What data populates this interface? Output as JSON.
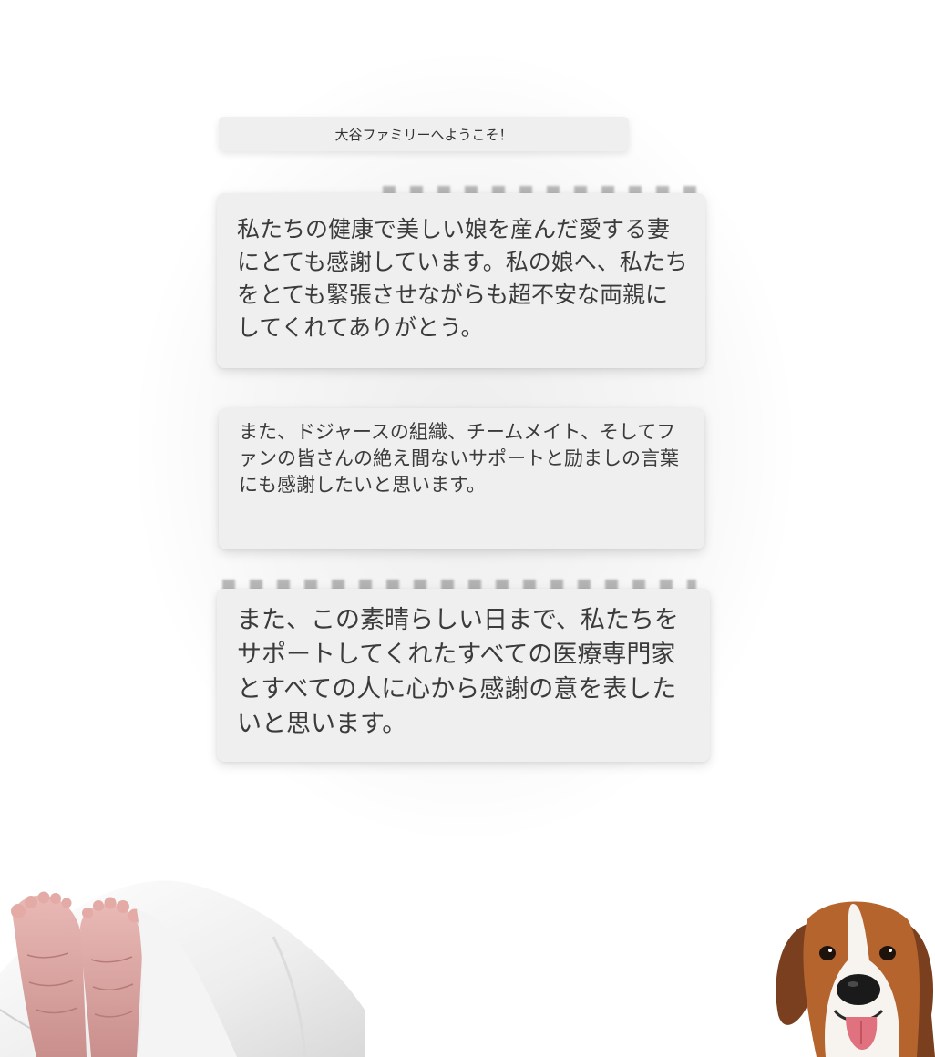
{
  "welcome_title": "大谷ファミリーへようこそ！",
  "messages": [
    {
      "text": "私たちの健康で美しい娘を産んだ愛する妻にとても感謝しています。私の娘へ、私たちをとても緊張させながらも超不安な両親にしてくれてありがとう。"
    },
    {
      "text": "また、ドジャースの組織、チームメイト、そしてファンの皆さんの絶え間ないサポートと励ましの言葉にも感謝したいと思います。"
    },
    {
      "text": "また、この素晴らしい日まで、私たちをサポートしてくれたすべての医療専門家とすべての人に心から感謝の意を表したいと思います。"
    }
  ],
  "colors": {
    "card_background": "#efefef",
    "text": "#3b3b3b",
    "page_background": "#ffffff"
  },
  "images": [
    {
      "name": "baby-feet",
      "description_icon": "baby-feet-in-white-blanket"
    },
    {
      "name": "dog",
      "description_icon": "beagle-dog-face"
    }
  ]
}
